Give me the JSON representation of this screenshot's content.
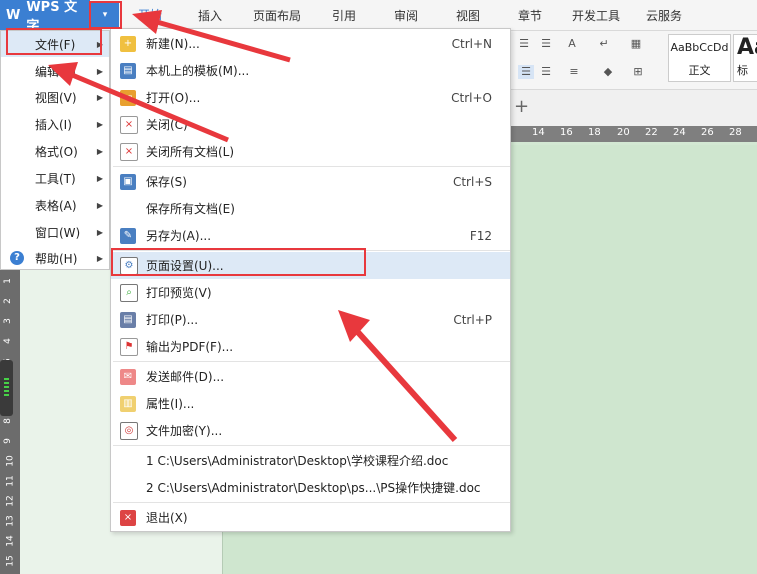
{
  "app": {
    "logo_letter": "W",
    "name": "WPS 文字",
    "dropdown_glyph": "▾"
  },
  "ribbon_tabs": [
    "开始",
    "插入",
    "页面布局",
    "引用",
    "审阅",
    "视图",
    "章节",
    "开发工具",
    "云服务"
  ],
  "styles": {
    "preview_text": "AaBbCcDd",
    "normal_label": "正文",
    "big_preview": "Aa",
    "heading_fragment": "标"
  },
  "doc_tab_plus": "+",
  "ruler_h": [
    "14",
    "16",
    "18",
    "20",
    "22",
    "24",
    "26",
    "28"
  ],
  "ruler_v": [
    "1",
    "2",
    "3",
    "4",
    "5",
    "6",
    "7",
    "8",
    "9",
    "10",
    "11",
    "12",
    "13",
    "14",
    "15"
  ],
  "app_menu": [
    {
      "label": "文件(F)",
      "has_submenu": true
    },
    {
      "label": "编辑(E)",
      "has_submenu": true
    },
    {
      "label": "视图(V)",
      "has_submenu": true
    },
    {
      "label": "插入(I)",
      "has_submenu": true
    },
    {
      "label": "格式(O)",
      "has_submenu": true
    },
    {
      "label": "工具(T)",
      "has_submenu": true
    },
    {
      "label": "表格(A)",
      "has_submenu": true
    },
    {
      "label": "窗口(W)",
      "has_submenu": true
    },
    {
      "label": "帮助(H)",
      "has_submenu": true
    }
  ],
  "file_menu": [
    {
      "label": "新建(N)...",
      "shortcut": "Ctrl+N",
      "icon": "new-doc-icon"
    },
    {
      "label": "本机上的模板(M)...",
      "shortcut": "",
      "icon": "template-icon"
    },
    {
      "label": "打开(O)...",
      "shortcut": "Ctrl+O",
      "icon": "open-folder-icon"
    },
    {
      "label": "关闭(C)",
      "shortcut": "",
      "icon": "close-doc-icon"
    },
    {
      "label": "关闭所有文档(L)",
      "shortcut": "",
      "icon": "close-all-icon"
    },
    {
      "label": "保存(S)",
      "shortcut": "Ctrl+S",
      "icon": "save-icon"
    },
    {
      "label": "保存所有文档(E)",
      "shortcut": "",
      "icon": ""
    },
    {
      "label": "另存为(A)...",
      "shortcut": "F12",
      "icon": "save-as-icon"
    },
    {
      "label": "页面设置(U)...",
      "shortcut": "",
      "icon": "page-setup-icon"
    },
    {
      "label": "打印预览(V)",
      "shortcut": "",
      "icon": "print-preview-icon"
    },
    {
      "label": "打印(P)...",
      "shortcut": "Ctrl+P",
      "icon": "print-icon"
    },
    {
      "label": "输出为PDF(F)...",
      "shortcut": "",
      "icon": "pdf-icon"
    },
    {
      "label": "发送邮件(D)...",
      "shortcut": "",
      "icon": "mail-icon"
    },
    {
      "label": "属性(I)...",
      "shortcut": "",
      "icon": "properties-icon"
    },
    {
      "label": "文件加密(Y)...",
      "shortcut": "",
      "icon": "encrypt-icon"
    },
    {
      "label": "1 C:\\Users\\Administrator\\Desktop\\学校课程介绍.doc",
      "shortcut": "",
      "icon": ""
    },
    {
      "label": "2 C:\\Users\\Administrator\\Desktop\\ps...\\PS操作快捷键.doc",
      "shortcut": "",
      "icon": ""
    },
    {
      "label": "退出(X)",
      "shortcut": "",
      "icon": "exit-icon"
    }
  ],
  "colors": {
    "accent": "#3b7fd2",
    "annotation_red": "#e8383d",
    "page_bg": "#cfe6cf"
  }
}
